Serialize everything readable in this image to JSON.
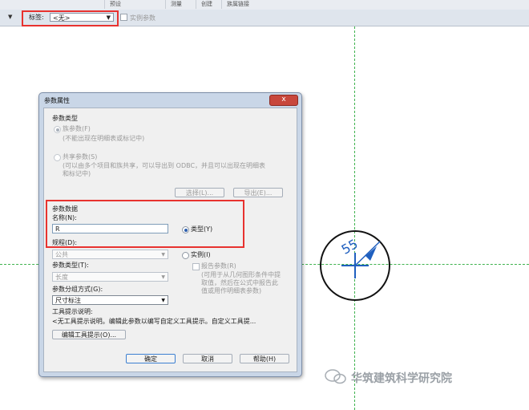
{
  "ribbon": {
    "tabs": [
      "预设",
      "测量",
      "创建",
      "族属链接"
    ]
  },
  "options_bar": {
    "tag_label": "标签:",
    "tag_value": "<无>",
    "instance_param_label": "实例参数"
  },
  "tag_symbol": {
    "value": "55"
  },
  "dialog": {
    "title": "参数属性",
    "close_glyph": "x",
    "param_type": {
      "heading": "参数类型",
      "family_param_label": "族参数(F)",
      "family_param_desc": "(不能出现在明细表或标记中)",
      "shared_param_label": "共享参数(S)",
      "shared_param_desc_1": "(可以由多个项目和族共享，可以导出到 ODBC，并且可以出现在明细表",
      "shared_param_desc_2": "和标记中)",
      "select_button": "选择(L)...",
      "export_button": "导出(E)..."
    },
    "param_data": {
      "heading": "参数数据",
      "name_label": "名称(N):",
      "name_value": "R",
      "type_radio_label": "类型(Y)",
      "discipline_label": "规程(D):",
      "discipline_value": "公共",
      "instance_radio_label": "实例(I)",
      "param_type_label": "参数类型(T):",
      "param_type_value": "长度",
      "report_param_label": "报告参数(R)",
      "report_desc_1": "(可用于从几何图形条件中提",
      "report_desc_2": "取值，然后在公式中报告此",
      "report_desc_3": "值或用作明细表参数)",
      "group_label": "参数分组方式(G):",
      "group_value": "尺寸标注",
      "tooltip_label": "工具提示说明:",
      "tooltip_value": "<无工具提示说明。编辑此参数以编写自定义工具提示。自定义工具提...",
      "edit_tooltip_button": "编辑工具提示(O)..."
    },
    "ok_button": "确定",
    "cancel_button": "取消",
    "help_button": "帮助(H)"
  },
  "watermark": {
    "text": "华筑建筑科学研究院"
  }
}
